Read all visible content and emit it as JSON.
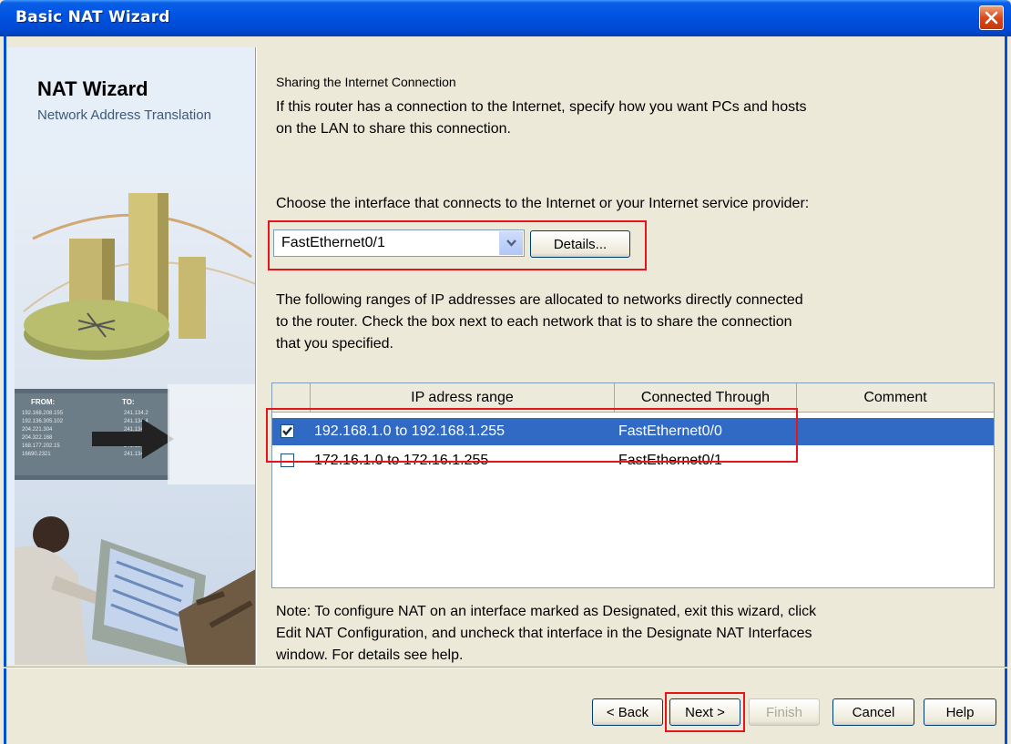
{
  "window": {
    "title": "Basic NAT Wizard"
  },
  "left": {
    "title": "NAT Wizard",
    "subtitle": "Network Address Translation"
  },
  "main": {
    "section_title": "Sharing the Internet Connection",
    "intro": [
      "If this router has a connection to the Internet, specify how you want PCs and hosts",
      "on the LAN to share this connection."
    ],
    "choose_label": "Choose the interface that connects to the Internet or your Internet service provider:",
    "interface_select": {
      "value": "FastEthernet0/1"
    },
    "details_button": "Details...",
    "ranges_text": [
      "The following ranges of IP addresses are allocated to networks directly connected",
      "to the router. Check the box next to each network that is to share the connection",
      "that you specified."
    ],
    "table": {
      "columns": [
        "IP adress range",
        "Connected Through",
        "Comment"
      ],
      "rows": [
        {
          "checked": true,
          "range": "192.168.1.0 to 192.168.1.255",
          "through": "FastEthernet0/0",
          "comment": ""
        },
        {
          "checked": false,
          "range": "172.16.1.0 to 172.16.1.255",
          "through": "FastEthernet0/1",
          "comment": ""
        }
      ]
    },
    "note": [
      "Note: To configure NAT on an interface marked as Designated, exit this wizard, click",
      "Edit NAT Configuration, and uncheck that interface in the Designate NAT Interfaces",
      "window. For details see help."
    ]
  },
  "footer": {
    "back": "< Back",
    "next": "Next >",
    "finish": "Finish",
    "cancel": "Cancel",
    "help": "Help"
  },
  "colors": {
    "titlebar": "#0054e3",
    "selection": "#316ac5",
    "highlight": "#e8141b"
  }
}
